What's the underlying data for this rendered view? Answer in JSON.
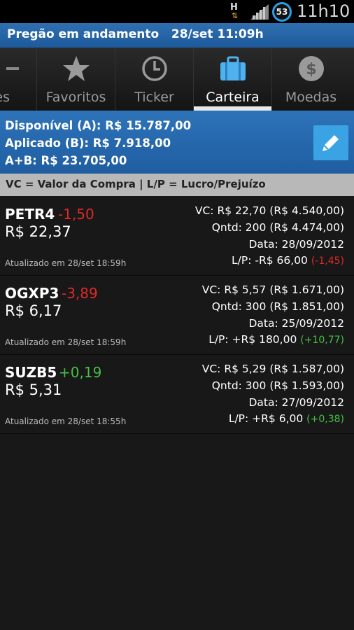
{
  "status_bar": {
    "network_h": "H",
    "battery": "53",
    "time": "11h10",
    "colors": {
      "battery_ring": "#2e9de8",
      "arrows": "#f0b030"
    }
  },
  "header": {
    "text": "Pregão em andamento   28/set 11:09h"
  },
  "tabs": [
    {
      "label": "es",
      "icon": "cut-off-icon",
      "active": false
    },
    {
      "label": "Favoritos",
      "icon": "star-icon",
      "active": false
    },
    {
      "label": "Ticker",
      "icon": "clock-icon",
      "active": false
    },
    {
      "label": "Carteira",
      "icon": "briefcase-icon",
      "active": true
    },
    {
      "label": "Moedas",
      "icon": "dollar-coin-icon",
      "active": false
    }
  ],
  "summary": {
    "disponivel": "Disponível (A): R$ 15.787,00",
    "aplicado": "Aplicado (B): R$ 7.918,00",
    "total": "A+B: R$ 23.705,00",
    "edit_icon": "pencil-icon"
  },
  "legend": "VC = Valor da Compra | L/P = Lucro/Prejuízo",
  "positions": [
    {
      "symbol": "PETR4",
      "change": "-1,50",
      "change_dir": "neg",
      "price": "R$ 22,37",
      "updated": "Atualizado em 28/set 18:59h",
      "vc": "VC: R$ 22,70 (R$ 4.540,00)",
      "qntd": "Qntd: 200 (R$ 4.474,00)",
      "data": "Data: 28/09/2012",
      "lp": "L/P: -R$ 66,00",
      "lp_pct": "(-1,45)",
      "lp_dir": "neg"
    },
    {
      "symbol": "OGXP3",
      "change": "-3,89",
      "change_dir": "neg",
      "price": "R$ 6,17",
      "updated": "Atualizado em 28/set 18:59h",
      "vc": "VC: R$ 5,57 (R$ 1.671,00)",
      "qntd": "Qntd: 300 (R$ 1.851,00)",
      "data": "Data: 25/09/2012",
      "lp": "L/P: +R$ 180,00",
      "lp_pct": "(+10,77)",
      "lp_dir": "pos"
    },
    {
      "symbol": "SUZB5",
      "change": "+0,19",
      "change_dir": "pos",
      "price": "R$ 5,31",
      "updated": "Atualizado em 28/set 18:55h",
      "vc": "VC: R$ 5,29 (R$ 1.587,00)",
      "qntd": "Qntd: 300 (R$ 1.593,00)",
      "data": "Data: 27/09/2012",
      "lp": "L/P: +R$ 6,00",
      "lp_pct": "(+0,38)",
      "lp_dir": "pos"
    }
  ]
}
